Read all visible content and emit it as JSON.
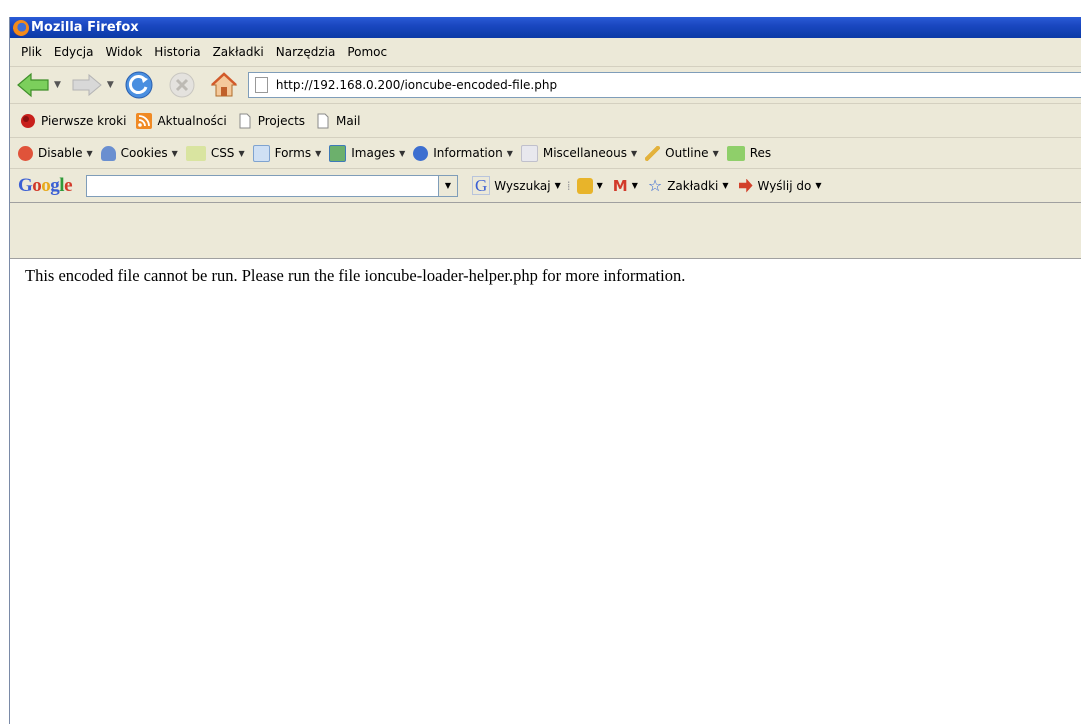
{
  "window": {
    "title": "Mozilla Firefox"
  },
  "menu": [
    "Plik",
    "Edycja",
    "Widok",
    "Historia",
    "Zakładki",
    "Narzędzia",
    "Pomoc"
  ],
  "navigation": {
    "url": "http://192.168.0.200/ioncube-encoded-file.php"
  },
  "bookmarks": [
    "Pierwsze kroki",
    "Aktualności",
    "Projects",
    "Mail"
  ],
  "webdev_toolbar": [
    "Disable",
    "Cookies",
    "CSS",
    "Forms",
    "Images",
    "Information",
    "Miscellaneous",
    "Outline",
    "Res"
  ],
  "google_toolbar": {
    "logo": "Google",
    "search_value": "",
    "search_button": "Wyszukaj",
    "bookmarks_label": "Zakładki",
    "send_label": "Wyślij do"
  },
  "page": {
    "message": "This encoded file cannot be run. Please run the file ioncube-loader-helper.php for more information."
  },
  "colors": {
    "titlebar": "#0b3aa6",
    "chrome": "#ece9d8"
  }
}
